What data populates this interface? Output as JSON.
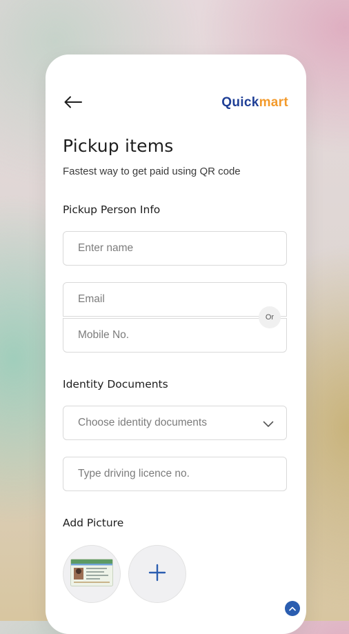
{
  "brand": {
    "part1": "Quick",
    "part2": "mart"
  },
  "header": {
    "title": "Pickup items",
    "subtitle": "Fastest way to get paid using QR code"
  },
  "pickup_person": {
    "section_label": "Pickup Person Info",
    "name_placeholder": "Enter name",
    "email_placeholder": "Email",
    "or_label": "Or",
    "mobile_placeholder": "Mobile No."
  },
  "identity": {
    "section_label": "Identity Documents",
    "select_placeholder": "Choose identity documents",
    "licence_placeholder": "Type driving licence no."
  },
  "picture": {
    "section_label": "Add Picture",
    "add_symbol": "+"
  },
  "colors": {
    "brand_blue": "#1f3f96",
    "brand_orange": "#f39a2b",
    "accent": "#2a5db0"
  }
}
